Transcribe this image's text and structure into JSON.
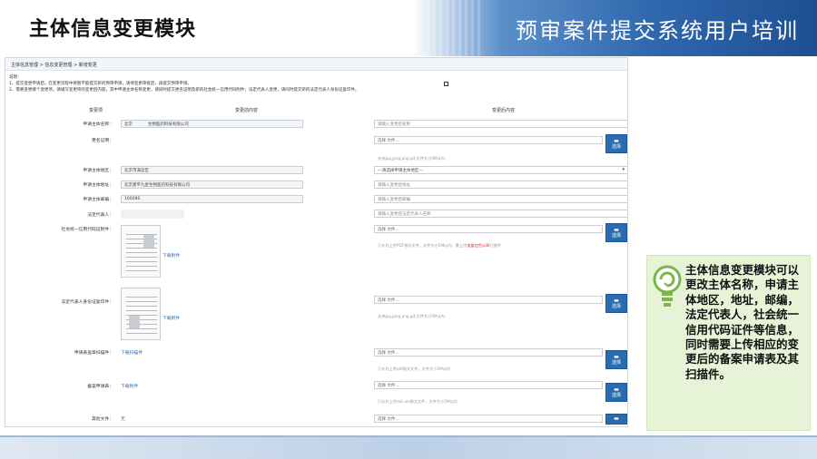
{
  "slide": {
    "title": "主体信息变更模块",
    "banner": "预审案件提交系统用户培训"
  },
  "breadcrumb": "主体信息管理 > 信息变更管理 > 新增变更",
  "notes": {
    "heading": "说明：",
    "line1": "1、提交变更申请后，在变更流程中将暂不能提交新的预审申请，请待变更审批后，再提交预审申请。",
    "line2": "2、需要变更哪个变更项，请填写变更项的变更后内容，其中申请主体名称变更，请同时提交更名证明及新的社会统一信用代码附件；法定代表人变更，请同时提交新的法定代表人身份证复印件。"
  },
  "columns": {
    "item": "变更项",
    "before": "变更前内容",
    "after": "变更后内容"
  },
  "rows": {
    "name": {
      "label": "申请主体名称：",
      "old_a": "北京",
      "old_b": "生物医药科技有限公司",
      "placeholder": "请输入变更后名称"
    },
    "rename_proof": {
      "label": "更名证明：",
      "file": "选择 文件...",
      "btn": "选择",
      "hint": "支持jpg,jpeg,png,gif,文件大小5M以内"
    },
    "region": {
      "label": "申请主体地区：",
      "old": "北京市海淀区",
      "dropdown": "---请选择申请主体地区---"
    },
    "address": {
      "label": "申请主体地址：",
      "old": "北京建平九星生物医药科技有限公司",
      "placeholder": "请输入变更后地址"
    },
    "postcode": {
      "label": "申请主体邮编：",
      "old": "100086",
      "placeholder": "请输入变更后邮编"
    },
    "legal_rep": {
      "label": "法定代表人：",
      "placeholder": "请输入变更后法定代表人名称"
    },
    "credit_code": {
      "label": "社会统一信用代码证附件：",
      "download": "下载附件",
      "file": "选择 文件...",
      "btn": "选择",
      "hint_a": "只允许上传PDF格式文件，文件大小5M以内，需上传",
      "hint_red": "加盖红色公章",
      "hint_b": "扫描件"
    },
    "id_card": {
      "label": "法定代表人身份证复印件：",
      "download": "下载附件",
      "file": "选择 文件...",
      "btn": "选择",
      "hint": "支持jpg,jpeg,png,gif,文件大小5M以内"
    },
    "request_scan": {
      "label": "申请表盖章扫描件：",
      "download": "下载扫描件",
      "file": "选择 文件...",
      "btn": "选择",
      "hint": "只允许上传pdf格式文件，文件大小5M以内"
    },
    "record_form": {
      "label": "备案申请表：",
      "download": "下载附件",
      "file": "选择 文件...",
      "btn": "选择",
      "hint": "只允许上传doc,xls格式文件，文件大小5M以内"
    },
    "other": {
      "label": "其他文件：",
      "value": "无",
      "file": "选择 文件..."
    }
  },
  "callout": {
    "text": "主体信息变更模块可以更改主体名称，申请主体地区，地址，邮编，法定代表人，社会统一信用代码证件等信息，同时需要上传相应的变更后的备案申请表及其扫描件。"
  },
  "colors": {
    "banner": "#2f67ad",
    "button": "#2b6cb0",
    "callout_bg": "#e6f3d6",
    "bulb": "#7ab648"
  }
}
